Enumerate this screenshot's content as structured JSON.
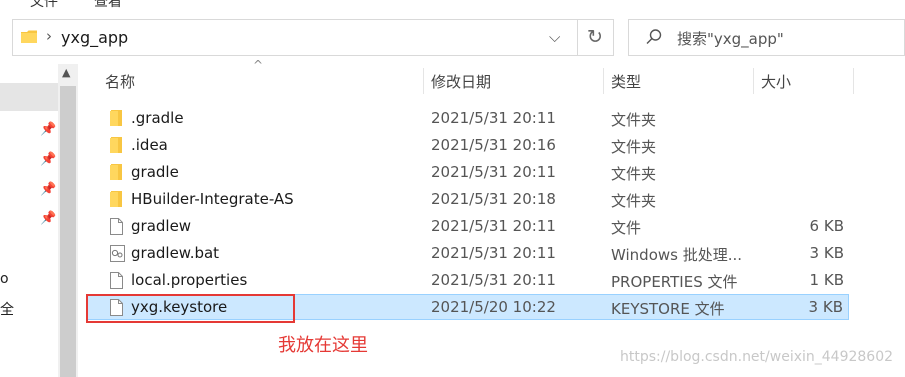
{
  "menu": {
    "items": [
      "文件",
      "查看"
    ]
  },
  "address_bar": {
    "path": "yxg_app"
  },
  "search": {
    "placeholder": "搜索\"yxg_app\""
  },
  "nav": {
    "fragments": [
      "o",
      "全"
    ]
  },
  "columns": {
    "name": "名称",
    "date": "修改日期",
    "type": "类型",
    "size": "大小"
  },
  "files": [
    {
      "name": ".gradle",
      "date": "2021/5/31 20:11",
      "type": "文件夹",
      "size": "",
      "icon": "folder-icon"
    },
    {
      "name": ".idea",
      "date": "2021/5/31 20:16",
      "type": "文件夹",
      "size": "",
      "icon": "folder-icon"
    },
    {
      "name": "gradle",
      "date": "2021/5/31 20:11",
      "type": "文件夹",
      "size": "",
      "icon": "folder-icon"
    },
    {
      "name": "HBuilder-Integrate-AS",
      "date": "2021/5/31 20:18",
      "type": "文件夹",
      "size": "",
      "icon": "folder-icon"
    },
    {
      "name": "gradlew",
      "date": "2021/5/31 20:11",
      "type": "文件",
      "size": "6 KB",
      "icon": "file-icon"
    },
    {
      "name": "gradlew.bat",
      "date": "2021/5/31 20:11",
      "type": "Windows 批处理...",
      "size": "3 KB",
      "icon": "batch-file-icon"
    },
    {
      "name": "local.properties",
      "date": "2021/5/31 20:11",
      "type": "PROPERTIES 文件",
      "size": "1 KB",
      "icon": "file-icon"
    },
    {
      "name": "yxg.keystore",
      "date": "2021/5/20 10:22",
      "type": "KEYSTORE 文件",
      "size": "3 KB",
      "icon": "file-icon",
      "selected": true
    }
  ],
  "annotation": {
    "note": "我放在这里"
  },
  "watermark": "https://blog.csdn.net/weixin_44928602",
  "colors": {
    "folder": "#f8c642",
    "selection": "#cce8ff",
    "annotation": "#e53935"
  }
}
